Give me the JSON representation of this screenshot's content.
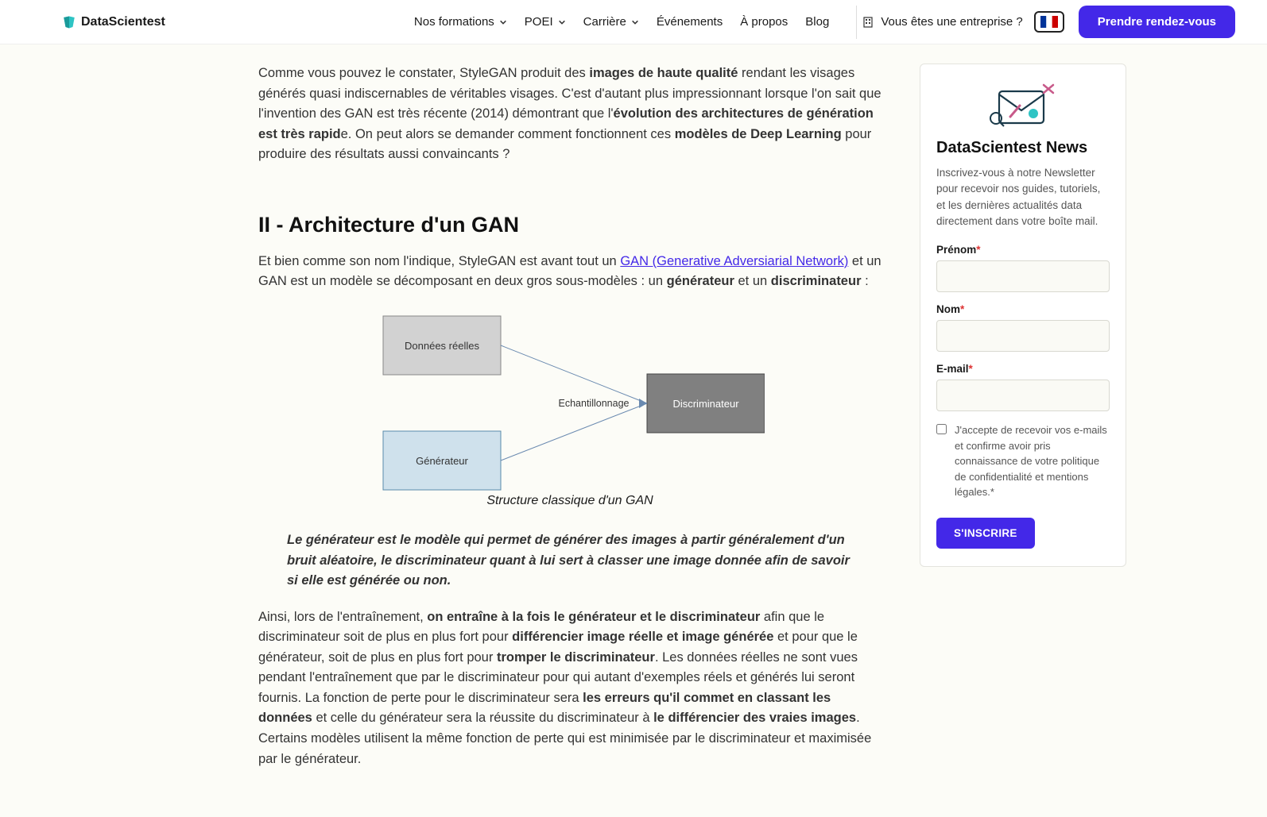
{
  "header": {
    "brand": "DataScientest",
    "nav": [
      {
        "label": "Nos formations",
        "chevron": true
      },
      {
        "label": "POEI",
        "chevron": true
      },
      {
        "label": "Carrière",
        "chevron": true
      },
      {
        "label": "Événements",
        "chevron": false
      },
      {
        "label": "À propos",
        "chevron": false
      },
      {
        "label": "Blog",
        "chevron": false
      }
    ],
    "enterprise": "Vous êtes une entreprise ?",
    "cta": "Prendre rendez-vous"
  },
  "article": {
    "p1_a": "Comme vous pouvez le constater, StyleGAN produit des ",
    "p1_b": "images de haute qualité",
    "p1_c": " rendant les visages générés quasi indiscernables de véritables visages. C'est d'autant plus impressionnant lorsque l'on sait que l'invention des GAN est très récente (2014) démontrant que l'",
    "p1_d": "évolution des architectures de génération est très rapid",
    "p1_e": "e. On peut alors se demander comment fonctionnent ces ",
    "p1_f": "modèles de Deep Learning",
    "p1_g": " pour produire des résultats aussi convaincants ?",
    "h2": "II - Architecture d'un GAN",
    "p2_a": "Et bien comme son nom l'indique, StyleGAN est avant tout un ",
    "p2_link": "GAN (Generative Adversiarial Network)",
    "p2_b": " et un GAN est un modèle se décomposant en deux gros sous-modèles : un ",
    "p2_c": "générateur",
    "p2_d": " et un ",
    "p2_e": "discriminateur",
    "p2_f": " :",
    "diagram": {
      "box1": "Données réelles",
      "box2": "Générateur",
      "mid": "Echantillonnage",
      "box3": "Discriminateur"
    },
    "caption": "Structure classique d'un GAN",
    "quote": "Le générateur est le modèle qui permet de générer des images à partir généralement d'un bruit aléatoire, le discriminateur quant à lui sert à classer une image donnée afin de savoir si elle est générée ou non.",
    "p3_a": "Ainsi, lors de l'entraînement, ",
    "p3_b": "on entraîne à la fois le générateur et le discriminateur",
    "p3_c": " afin que le discriminateur soit de plus en plus fort pour ",
    "p3_d": "différencier image réelle et image générée",
    "p3_e": " et pour que le générateur, soit de plus en plus fort pour ",
    "p3_f": "tromper le discriminateur",
    "p3_g": ". Les données réelles ne sont vues pendant l'entraînement que par le discriminateur pour qui autant d'exemples réels et générés lui seront fournis. La fonction de perte pour le discriminateur sera ",
    "p3_h": "les erreurs qu'il commet en classant les données",
    "p3_i": " et celle du générateur sera la réussite du discriminateur à ",
    "p3_j": "le différencier des vraies images",
    "p3_k": ". Certains modèles utilisent la même fonction de perte qui est minimisée par le discriminateur et maximisée par le générateur."
  },
  "sidebar": {
    "title": "DataScientest News",
    "desc": "Inscrivez-vous à notre Newsletter pour recevoir nos guides, tutoriels, et les dernières actualités data directement dans votre boîte mail.",
    "fields": {
      "firstname": "Prénom",
      "lastname": "Nom",
      "email": "E-mail",
      "consent": "J'accepte de recevoir vos e-mails et confirme avoir pris connaissance de votre politique de confidentialité et mentions légales."
    },
    "required": "*",
    "submit": "S'INSCRIRE"
  }
}
